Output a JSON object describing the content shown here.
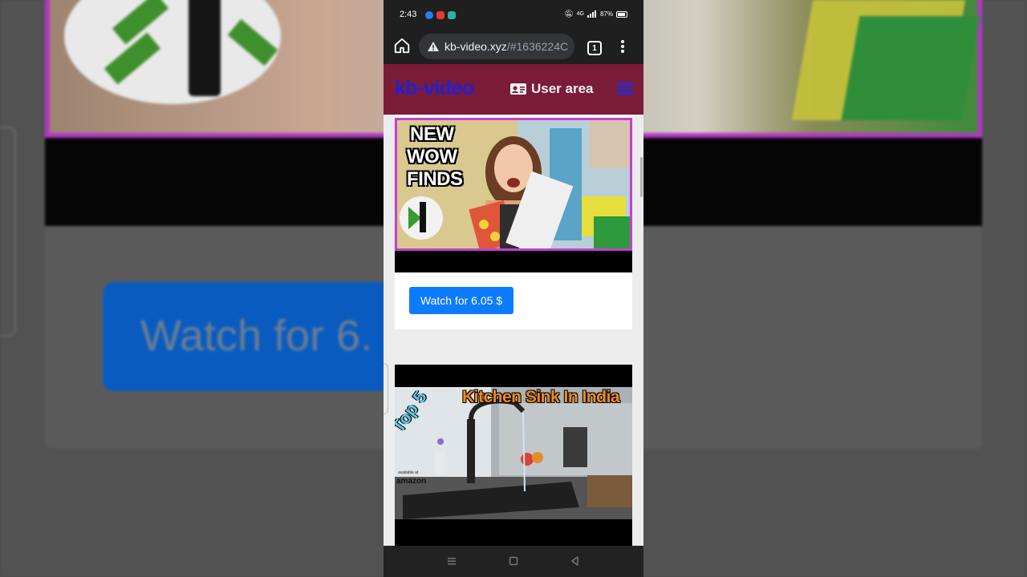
{
  "status_bar": {
    "time": "2:43",
    "battery": "87%",
    "network": "4G"
  },
  "browser": {
    "url_host": "kb-video.xyz",
    "url_path": "/#1636224C",
    "tab_count": "1",
    "icons": [
      "home-icon",
      "warning-icon",
      "tabs-icon",
      "more-vert-icon"
    ]
  },
  "site": {
    "brand": "kb-video",
    "user_area_label": "User area",
    "colors": {
      "header": "#7a1c38",
      "brand": "#2020d8",
      "button": "#0d7bff"
    }
  },
  "videos": [
    {
      "thumb_text": [
        "NEW",
        "WOW",
        "FINDS"
      ],
      "watch_label": "Watch for 6.05 $"
    },
    {
      "thumb_title": "Kitchen Sink In India",
      "thumb_badge": "Top 5",
      "thumb_brand": "amazon",
      "thumb_avail": "available at"
    }
  ],
  "background": {
    "watch_label": "Watch for 6."
  }
}
